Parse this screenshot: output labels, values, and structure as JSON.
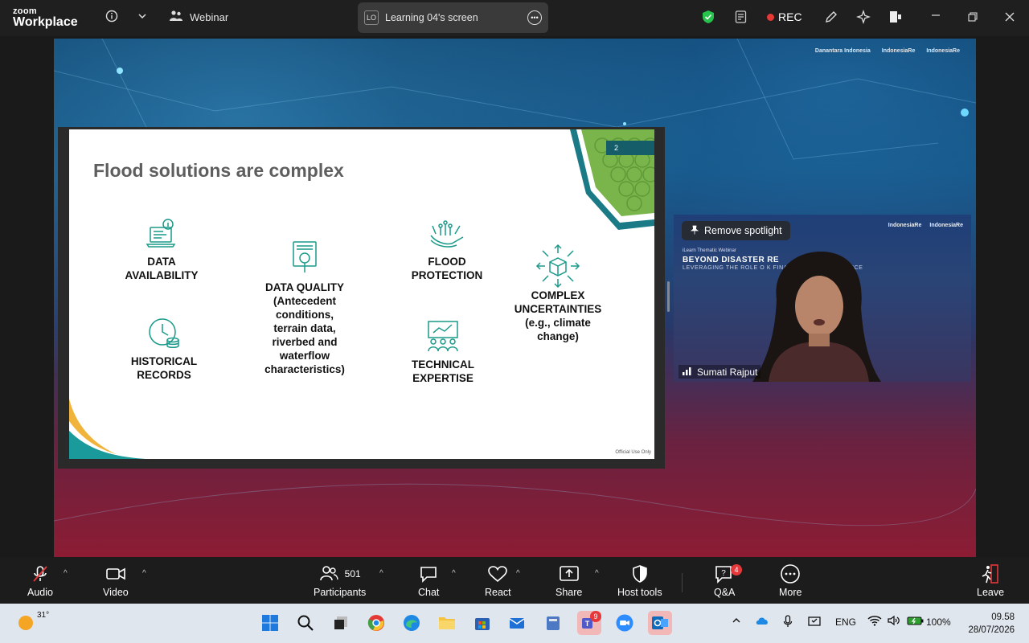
{
  "app": {
    "logo_line1": "zoom",
    "logo_line2": "Workplace",
    "meeting_type": "Webinar"
  },
  "screen_share": {
    "initials": "LO",
    "label": "Learning 04's screen"
  },
  "recording": {
    "label": "REC"
  },
  "colors": {
    "slide_teal": "#1a9a8a",
    "rec_red": "#e53935",
    "badge_red": "#e5383b"
  },
  "stage_logos": [
    "Danantara Indonesia",
    "IndonesiaRe",
    "IndonesiaRe"
  ],
  "slide": {
    "page_number": "2",
    "title": "Flood solutions are complex",
    "items": [
      {
        "label": "DATA\nAVAILABILITY",
        "icon": "laptop-info-icon"
      },
      {
        "label": "DATA QUALITY\n(Antecedent\nconditions,\nterrain data,\nriverbed and\nwaterflow\ncharacteristics)",
        "icon": "document-magnifier-icon"
      },
      {
        "label": "FLOOD\nPROTECTION",
        "icon": "hand-network-icon"
      },
      {
        "label": "COMPLEX\nUNCERTAINTIES\n(e.g., climate\nchange)",
        "icon": "cube-arrows-icon"
      },
      {
        "label": "HISTORICAL\nRECORDS",
        "icon": "clock-database-icon"
      },
      {
        "label": "TECHNICAL\nEXPERTISE",
        "icon": "team-board-icon"
      }
    ],
    "footer": "Official Use Only"
  },
  "video": {
    "spotlight_label": "Remove spotlight",
    "logos": [
      "IndonesiaRe",
      "IndonesiaRe"
    ],
    "kicker": "iLearn Thematic Webinar",
    "headline": "BEYOND DISASTER RE",
    "subline": "LEVERAGING THE ROLE O           K FINANCING AND INSURANCE",
    "participant_name": "Sumati Rajput"
  },
  "toolbar": {
    "audio": "Audio",
    "video": "Video",
    "participants": "Participants",
    "participants_count": "501",
    "chat": "Chat",
    "react": "React",
    "share": "Share",
    "host_tools": "Host tools",
    "qa": "Q&A",
    "qa_badge": "4",
    "more": "More",
    "leave": "Leave"
  },
  "taskbar": {
    "temperature": "31°",
    "teams_badge": "9",
    "language": "ENG",
    "battery": "100%",
    "time": "09.58",
    "date": "28/07/2026"
  }
}
